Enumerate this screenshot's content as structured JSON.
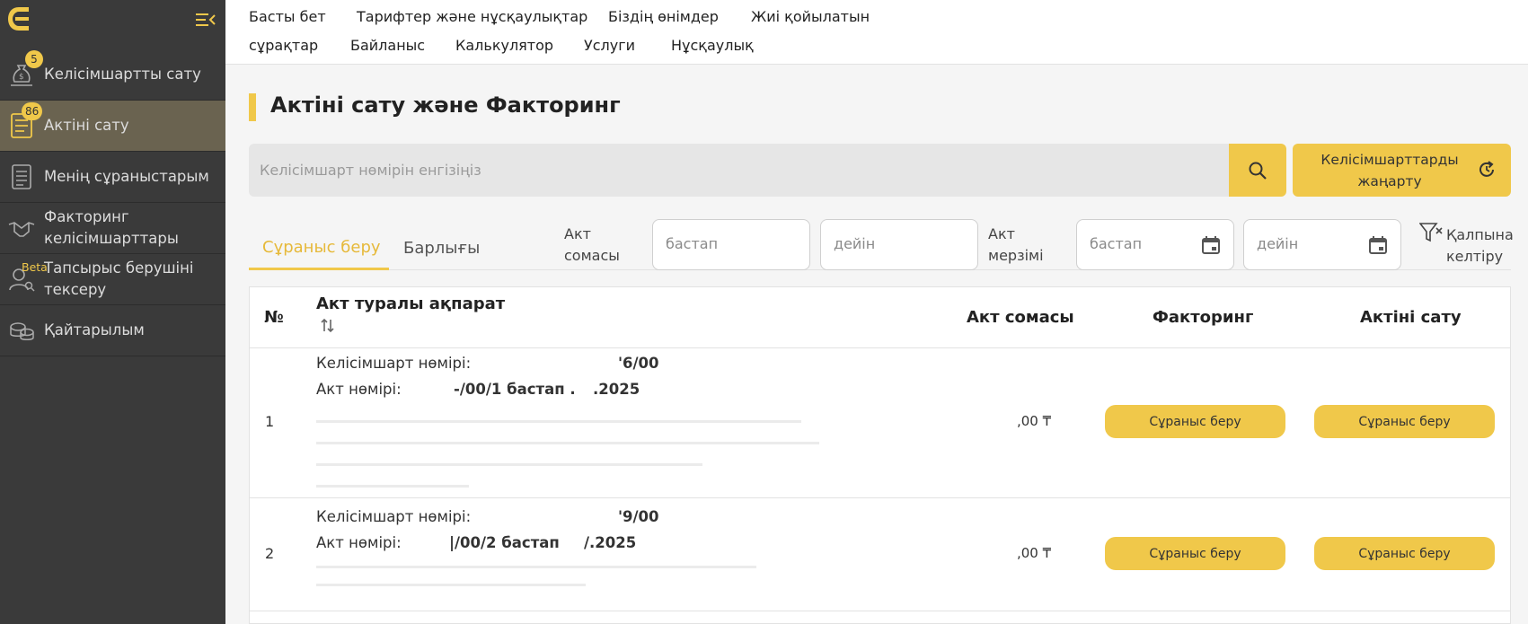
{
  "sidebar": {
    "items": [
      {
        "label": "Келісімшартты сату",
        "badge": "5"
      },
      {
        "label": "Актіні сату",
        "badge": "86"
      },
      {
        "label": "Менің сұраныстарым"
      },
      {
        "label": "Факторинг келісімшарттары"
      },
      {
        "label": "Тапсырыс берушіні тексеру",
        "badge": "Beta"
      },
      {
        "label": "Қайтарылым"
      }
    ]
  },
  "topnav": {
    "links": [
      "Басты бет",
      "Тарифтер және нұсқаулықтар",
      "Біздің өнімдер",
      "Жиі қойылатын",
      "сұрақтар",
      "Байланыс",
      "Калькулятор",
      "Услуги",
      "Нұсқаулық"
    ]
  },
  "main": {
    "title": "Актіні сату және Факторинг",
    "search_placeholder": "Келісімшарт нөмірін енгізіңіз",
    "refresh_label": "Келісімшарттарды жаңарту",
    "tabs": [
      "Сұраныс беру",
      "Барлығы"
    ],
    "filters": {
      "amount_label": "Акт сомасы",
      "from_placeholder": "бастап",
      "to_placeholder": "дейін",
      "term_label": "Акт мерзімі",
      "reset_label": "Қалпына келтіру"
    }
  },
  "table": {
    "headers": [
      "№",
      "Акт туралы ақпарат",
      "Акт сомасы",
      "Факторинг",
      "Актіні сату"
    ],
    "rows": [
      {
        "num": "1",
        "contract_label": "Келісімшарт нөмірі:",
        "contract_value": "'6/00",
        "act_label": "Акт нөмірі:",
        "act_value": "-/00/1 бастап .",
        "act_date": ".2025",
        "amount": ",00 ₸",
        "factoring_btn": "Сұраныс беру",
        "sale_btn": "Сұраныс беру"
      },
      {
        "num": "2",
        "contract_label": "Келісімшарт нөмірі:",
        "contract_value": "'9/00",
        "act_label": "Акт нөмірі:",
        "act_value": "|/00/2 бастап",
        "act_date": "/.2025",
        "amount": ",00 ₸",
        "factoring_btn": "Сұраныс беру",
        "sale_btn": "Сұраныс беру"
      }
    ]
  },
  "colors": {
    "accent": "#f0c84a",
    "sidebar_bg": "#3a3a3a",
    "active_item": "#6a6350"
  }
}
